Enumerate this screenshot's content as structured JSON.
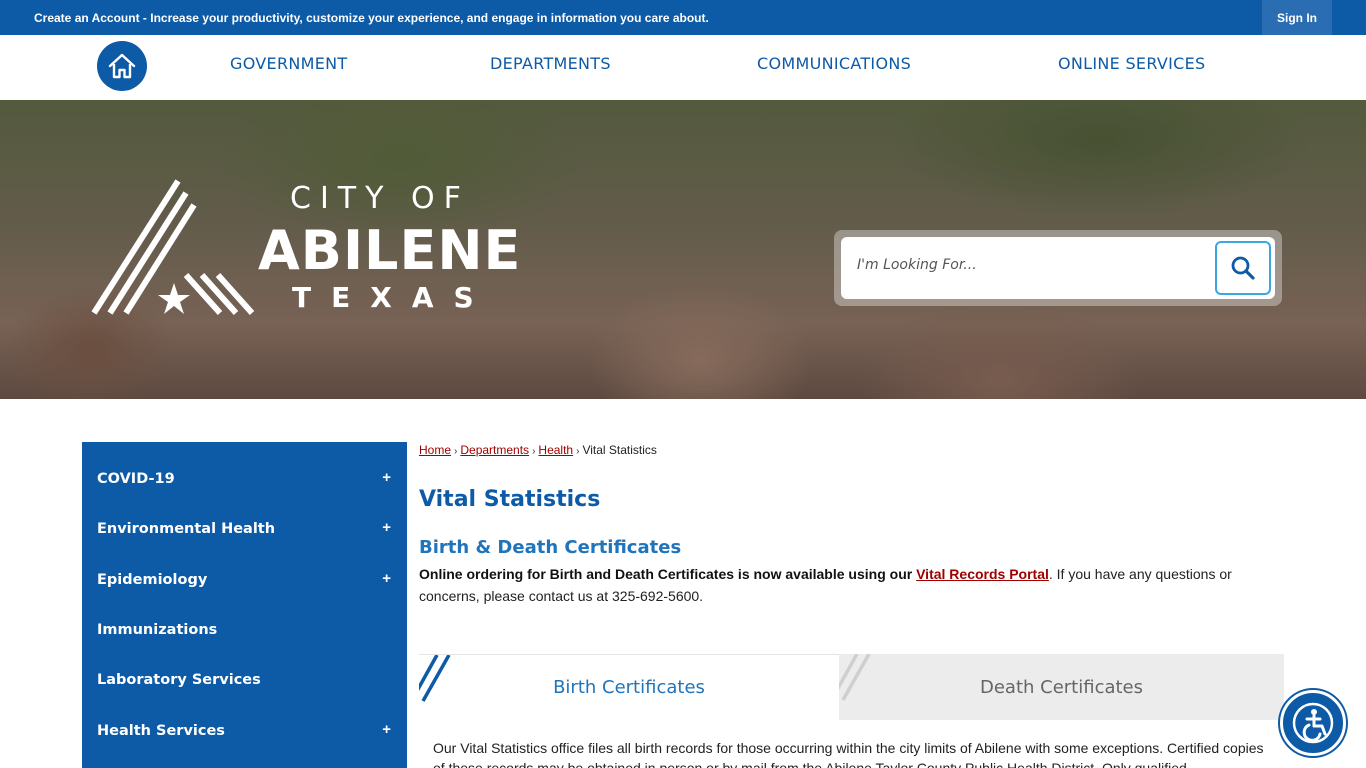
{
  "topbar": {
    "message": "Create an Account - Increase your productivity, customize your experience, and engage in information you care about.",
    "sign_in": "Sign In"
  },
  "nav": {
    "items": [
      "GOVERNMENT",
      "DEPARTMENTS",
      "COMMUNICATIONS",
      "ONLINE SERVICES"
    ]
  },
  "logo": {
    "line1": "CITY OF",
    "line2": "ABILENE",
    "line3": "TEXAS"
  },
  "search": {
    "placeholder": "I'm Looking For..."
  },
  "sidebar": {
    "items": [
      {
        "label": "COVID-19",
        "expand": "+"
      },
      {
        "label": "Environmental Health",
        "expand": "+"
      },
      {
        "label": "Epidemiology",
        "expand": "+"
      },
      {
        "label": "Immunizations",
        "expand": ""
      },
      {
        "label": "Laboratory Services",
        "expand": ""
      },
      {
        "label": "Health Services",
        "expand": "+"
      }
    ]
  },
  "breadcrumb": {
    "home": "Home",
    "departments": "Departments",
    "health": "Health",
    "current": "Vital Statistics",
    "separator": "›"
  },
  "main": {
    "title": "Vital Statistics",
    "subtitle": "Birth & Death Certificates",
    "para_bold": "Online ordering for Birth and Death Certificates is now available using our",
    "para_link": "Vital Records Portal",
    "para_rest": ". If you have any questions or concerns, please contact us at 325-692-5600.",
    "tabs": [
      "Birth Certificates",
      "Death Certificates"
    ],
    "tab_body": "Our Vital Statistics office files all birth records for those occurring within the city limits of Abilene with some exceptions. Certified copies of these records may be obtained in person or by mail from the Abilene Taylor County Public Health District. Only qualified"
  },
  "colors": {
    "brand_blue": "#0d5aa7",
    "link_red": "#a00000",
    "accent_light_blue": "#3aa7e0"
  }
}
